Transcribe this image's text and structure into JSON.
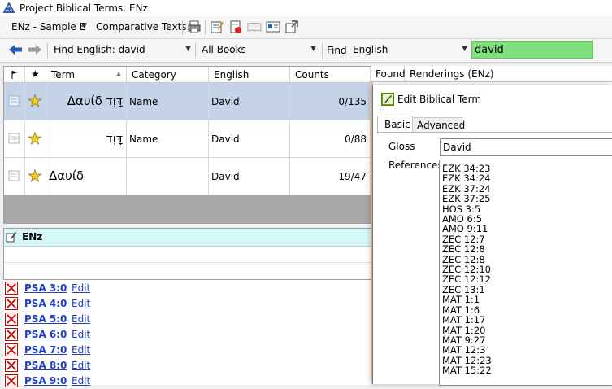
{
  "window": {
    "title": "Project Biblical Terms: ENz"
  },
  "toolbar1": {
    "project_label": "ENz - Sample E",
    "comparative_label": "Comparative Texts"
  },
  "toolbar2": {
    "find_label": "Find English: david",
    "books_label": "All Books",
    "find_text": "Find",
    "language_value": "English",
    "search_value": "david"
  },
  "grid": {
    "columns": [
      "Term",
      "Category",
      "English",
      "Counts",
      "Found",
      "Renderings (ENz)"
    ],
    "rows": [
      {
        "term": "Δαυίδ דָּוִד",
        "category": "Name",
        "english": "David",
        "counts": "0/135",
        "selected": true
      },
      {
        "term": "דָּוִד",
        "category": "Name",
        "english": "David",
        "counts": "0/88",
        "selected": false
      },
      {
        "term": "Δαυίδ",
        "category": "",
        "english": "David",
        "counts": "19/47",
        "selected": false
      }
    ]
  },
  "enz_panel": {
    "title": "ENz"
  },
  "verses": [
    {
      "ref": "PSA 3:0",
      "edit": "Edit"
    },
    {
      "ref": "PSA 4:0",
      "edit": "Edit"
    },
    {
      "ref": "PSA 5:0",
      "edit": "Edit"
    },
    {
      "ref": "PSA 6:0",
      "edit": "Edit"
    },
    {
      "ref": "PSA 7:0",
      "edit": "Edit"
    },
    {
      "ref": "PSA 8:0",
      "edit": "Edit"
    },
    {
      "ref": "PSA 9:0",
      "edit": "Edit"
    }
  ],
  "dialog": {
    "title": "Edit Biblical Term",
    "tabs": [
      "Basic",
      "Advanced"
    ],
    "gloss_label": "Gloss",
    "gloss_value": "David",
    "references_label": "References",
    "references": [
      "EZK 34:23",
      "EZK 34:24",
      "EZK 37:24",
      "EZK 37:25",
      "HOS 3:5",
      "AMO 6:5",
      "AMO 9:11",
      "ZEC 12:7",
      "ZEC 12:8",
      "ZEC 12:8",
      "ZEC 12:10",
      "ZEC 12:12",
      "ZEC 13:1",
      "MAT 1:1",
      "MAT 1:6",
      "MAT 1:17",
      "MAT 1:20",
      "MAT 9:27",
      "MAT 12:3",
      "MAT 12:23",
      "MAT 15:22"
    ]
  },
  "colors": {
    "search_highlight": "#80e080",
    "selected_row": "#c4d3e8",
    "link": "#1f3fc9",
    "enz_header": "#d6f7f7",
    "star": "#f0d020"
  }
}
